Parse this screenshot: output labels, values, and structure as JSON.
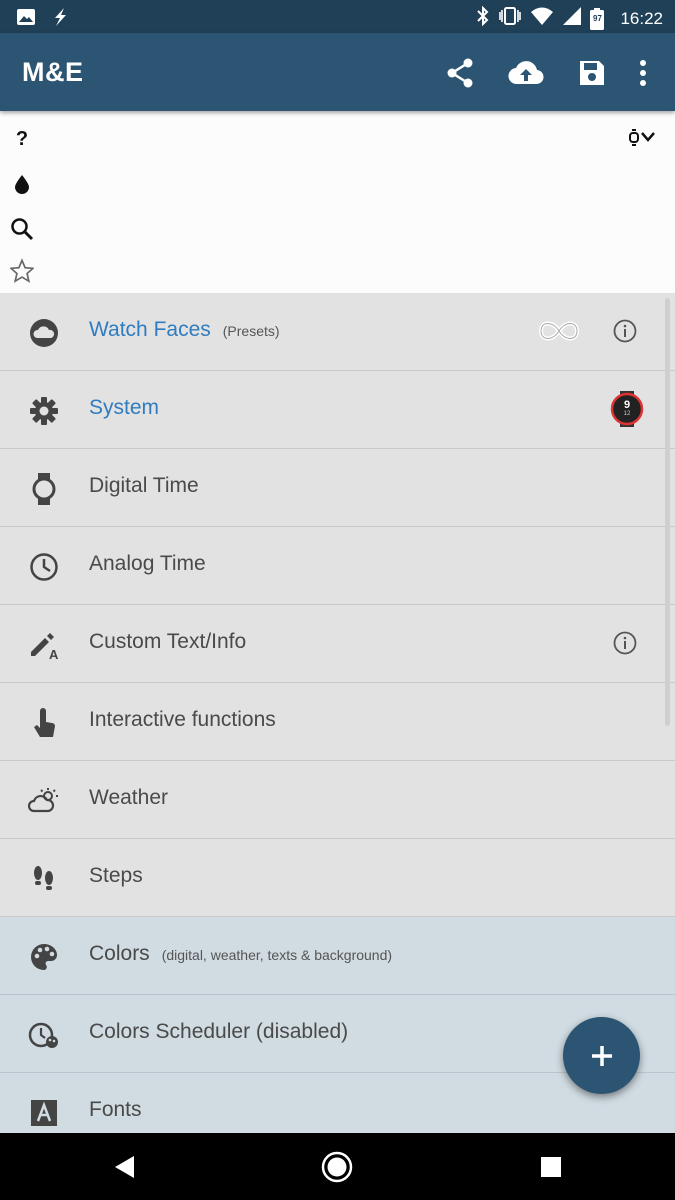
{
  "status_bar": {
    "time": "16:22",
    "battery": "97",
    "icons": [
      "image-icon",
      "flash-icon",
      "bluetooth-icon",
      "vibrate-icon",
      "wifi-icon",
      "signal-icon",
      "battery-icon"
    ]
  },
  "app_bar": {
    "title": "M&E",
    "actions": [
      "share-icon",
      "cloud-upload-icon",
      "save-icon",
      "more-vert-icon"
    ]
  },
  "tool_panel": {
    "icons": [
      "help-icon",
      "water-drop-icon",
      "search-icon",
      "star-outline-icon",
      "watch-toggle-icon"
    ]
  },
  "menu": {
    "items": [
      {
        "label": "Watch Faces",
        "sub": "(Presets)",
        "icon": "cloud-icon",
        "link": true
      },
      {
        "label": "System",
        "sub": "",
        "icon": "gear-icon",
        "link": true,
        "watch_preview": {
          "top": "9",
          "bottom": "12"
        }
      },
      {
        "label": "Digital Time",
        "sub": "",
        "icon": "watch-icon"
      },
      {
        "label": "Analog Time",
        "sub": "",
        "icon": "clock-icon"
      },
      {
        "label": "Custom Text/Info",
        "sub": "",
        "icon": "pen-text-icon"
      },
      {
        "label": "Interactive functions",
        "sub": "",
        "icon": "touch-icon"
      },
      {
        "label": "Weather",
        "sub": "",
        "icon": "weather-icon"
      },
      {
        "label": "Steps",
        "sub": "",
        "icon": "footsteps-icon"
      },
      {
        "label": "Colors",
        "sub": "(digital, weather, texts & background)",
        "icon": "palette-icon"
      },
      {
        "label": "Colors Scheduler (disabled)",
        "sub": "",
        "icon": "color-scheduler-icon"
      },
      {
        "label": "Fonts",
        "sub": "",
        "icon": "font-icon"
      }
    ]
  },
  "fab": {
    "icon": "plus-icon"
  },
  "nav_bar": {
    "icons": [
      "back-icon",
      "home-icon",
      "recents-icon"
    ]
  },
  "colors": {
    "status_bar": "#1f4057",
    "app_bar": "#2b5573",
    "link": "#2f7cc0",
    "row_bg": "#e2e2e2",
    "row_bg_blue": "#d0dbe2"
  }
}
